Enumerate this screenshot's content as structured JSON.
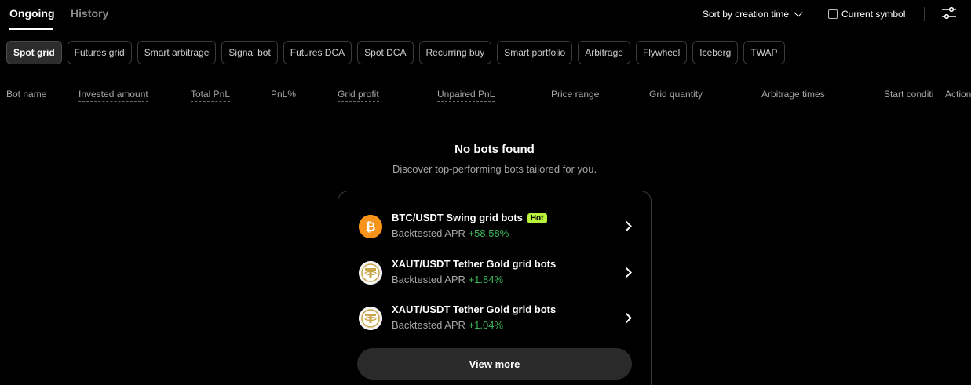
{
  "tabs": {
    "ongoing": "Ongoing",
    "history": "History"
  },
  "toolbar": {
    "sort_label": "Sort by creation time",
    "current_symbol_label": "Current symbol"
  },
  "chips": [
    "Spot grid",
    "Futures grid",
    "Smart arbitrage",
    "Signal bot",
    "Futures DCA",
    "Spot DCA",
    "Recurring buy",
    "Smart portfolio",
    "Arbitrage",
    "Flywheel",
    "Iceberg",
    "TWAP"
  ],
  "columns": [
    "Bot name",
    "Invested amount",
    "Total PnL",
    "PnL%",
    "Grid profit",
    "Unpaired PnL",
    "Price range",
    "Grid quantity",
    "Arbitrage times",
    "Start conditi",
    "Action"
  ],
  "empty": {
    "title": "No bots found",
    "subtitle": "Discover top-performing bots tailored for you."
  },
  "recommendations": [
    {
      "title": "BTC/USDT Swing grid bots",
      "badge": "Hot",
      "apr_label": "Backtested APR",
      "apr": "+58.58%",
      "icon": "bitcoin-icon"
    },
    {
      "title": "XAUT/USDT Tether Gold grid bots",
      "apr_label": "Backtested APR",
      "apr": "+1.84%",
      "icon": "tether-gold-icon"
    },
    {
      "title": "XAUT/USDT Tether Gold grid bots",
      "apr_label": "Backtested APR",
      "apr": "+1.04%",
      "icon": "tether-gold-icon"
    }
  ],
  "view_more": "View more",
  "colors": {
    "accent_green": "#3fb95c",
    "badge": "#b8f23a",
    "btc": "#f7931a"
  }
}
